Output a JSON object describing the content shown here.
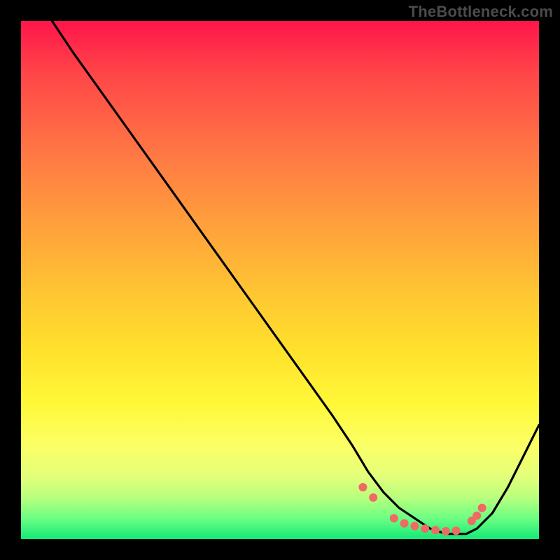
{
  "watermark": "TheBottleneck.com",
  "chart_data": {
    "type": "line",
    "title": "",
    "xlabel": "",
    "ylabel": "",
    "xlim": [
      0,
      100
    ],
    "ylim": [
      0,
      100
    ],
    "grid": false,
    "legend": false,
    "series": [
      {
        "name": "bottleneck-curve",
        "x": [
          6,
          10,
          15,
          20,
          25,
          30,
          35,
          40,
          45,
          50,
          55,
          60,
          64,
          67,
          70,
          73,
          76,
          79,
          82,
          84,
          86,
          88,
          91,
          94,
          97,
          100
        ],
        "y": [
          100,
          94,
          87,
          80,
          73,
          66,
          59,
          52,
          45,
          38,
          31,
          24,
          18,
          13,
          9,
          6,
          4,
          2,
          1,
          1,
          1,
          2,
          5,
          10,
          16,
          22
        ]
      }
    ],
    "markers": {
      "name": "highlight-dots",
      "points": [
        {
          "x": 66,
          "y": 10
        },
        {
          "x": 68,
          "y": 8
        },
        {
          "x": 72,
          "y": 4
        },
        {
          "x": 74,
          "y": 3
        },
        {
          "x": 76,
          "y": 2.5
        },
        {
          "x": 78,
          "y": 2
        },
        {
          "x": 80,
          "y": 1.7
        },
        {
          "x": 82,
          "y": 1.5
        },
        {
          "x": 84,
          "y": 1.6
        },
        {
          "x": 87,
          "y": 3.5
        },
        {
          "x": 88,
          "y": 4.5
        },
        {
          "x": 89,
          "y": 6
        }
      ]
    },
    "gradient_stops": [
      {
        "pos": 0.0,
        "color": "#ff154a"
      },
      {
        "pos": 0.1,
        "color": "#ff4548"
      },
      {
        "pos": 0.26,
        "color": "#ff7944"
      },
      {
        "pos": 0.4,
        "color": "#ffa23b"
      },
      {
        "pos": 0.52,
        "color": "#ffc433"
      },
      {
        "pos": 0.64,
        "color": "#ffe22c"
      },
      {
        "pos": 0.74,
        "color": "#fff839"
      },
      {
        "pos": 0.82,
        "color": "#fbff66"
      },
      {
        "pos": 0.88,
        "color": "#e3ff7a"
      },
      {
        "pos": 0.92,
        "color": "#b8ff7d"
      },
      {
        "pos": 0.96,
        "color": "#6cff83"
      },
      {
        "pos": 1.0,
        "color": "#14e977"
      }
    ]
  }
}
